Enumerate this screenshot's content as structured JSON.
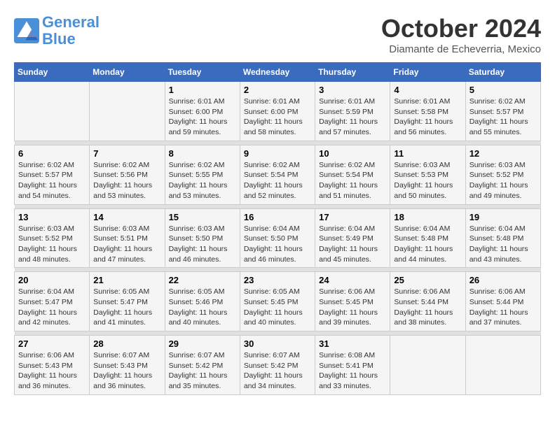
{
  "header": {
    "logo_line1": "General",
    "logo_line2": "Blue",
    "month": "October 2024",
    "location": "Diamante de Echeverria, Mexico"
  },
  "weekdays": [
    "Sunday",
    "Monday",
    "Tuesday",
    "Wednesday",
    "Thursday",
    "Friday",
    "Saturday"
  ],
  "weeks": [
    [
      {
        "day": "",
        "info": ""
      },
      {
        "day": "",
        "info": ""
      },
      {
        "day": "1",
        "info": "Sunrise: 6:01 AM\nSunset: 6:00 PM\nDaylight: 11 hours and 59 minutes."
      },
      {
        "day": "2",
        "info": "Sunrise: 6:01 AM\nSunset: 6:00 PM\nDaylight: 11 hours and 58 minutes."
      },
      {
        "day": "3",
        "info": "Sunrise: 6:01 AM\nSunset: 5:59 PM\nDaylight: 11 hours and 57 minutes."
      },
      {
        "day": "4",
        "info": "Sunrise: 6:01 AM\nSunset: 5:58 PM\nDaylight: 11 hours and 56 minutes."
      },
      {
        "day": "5",
        "info": "Sunrise: 6:02 AM\nSunset: 5:57 PM\nDaylight: 11 hours and 55 minutes."
      }
    ],
    [
      {
        "day": "6",
        "info": "Sunrise: 6:02 AM\nSunset: 5:57 PM\nDaylight: 11 hours and 54 minutes."
      },
      {
        "day": "7",
        "info": "Sunrise: 6:02 AM\nSunset: 5:56 PM\nDaylight: 11 hours and 53 minutes."
      },
      {
        "day": "8",
        "info": "Sunrise: 6:02 AM\nSunset: 5:55 PM\nDaylight: 11 hours and 53 minutes."
      },
      {
        "day": "9",
        "info": "Sunrise: 6:02 AM\nSunset: 5:54 PM\nDaylight: 11 hours and 52 minutes."
      },
      {
        "day": "10",
        "info": "Sunrise: 6:02 AM\nSunset: 5:54 PM\nDaylight: 11 hours and 51 minutes."
      },
      {
        "day": "11",
        "info": "Sunrise: 6:03 AM\nSunset: 5:53 PM\nDaylight: 11 hours and 50 minutes."
      },
      {
        "day": "12",
        "info": "Sunrise: 6:03 AM\nSunset: 5:52 PM\nDaylight: 11 hours and 49 minutes."
      }
    ],
    [
      {
        "day": "13",
        "info": "Sunrise: 6:03 AM\nSunset: 5:52 PM\nDaylight: 11 hours and 48 minutes."
      },
      {
        "day": "14",
        "info": "Sunrise: 6:03 AM\nSunset: 5:51 PM\nDaylight: 11 hours and 47 minutes."
      },
      {
        "day": "15",
        "info": "Sunrise: 6:03 AM\nSunset: 5:50 PM\nDaylight: 11 hours and 46 minutes."
      },
      {
        "day": "16",
        "info": "Sunrise: 6:04 AM\nSunset: 5:50 PM\nDaylight: 11 hours and 46 minutes."
      },
      {
        "day": "17",
        "info": "Sunrise: 6:04 AM\nSunset: 5:49 PM\nDaylight: 11 hours and 45 minutes."
      },
      {
        "day": "18",
        "info": "Sunrise: 6:04 AM\nSunset: 5:48 PM\nDaylight: 11 hours and 44 minutes."
      },
      {
        "day": "19",
        "info": "Sunrise: 6:04 AM\nSunset: 5:48 PM\nDaylight: 11 hours and 43 minutes."
      }
    ],
    [
      {
        "day": "20",
        "info": "Sunrise: 6:04 AM\nSunset: 5:47 PM\nDaylight: 11 hours and 42 minutes."
      },
      {
        "day": "21",
        "info": "Sunrise: 6:05 AM\nSunset: 5:47 PM\nDaylight: 11 hours and 41 minutes."
      },
      {
        "day": "22",
        "info": "Sunrise: 6:05 AM\nSunset: 5:46 PM\nDaylight: 11 hours and 40 minutes."
      },
      {
        "day": "23",
        "info": "Sunrise: 6:05 AM\nSunset: 5:45 PM\nDaylight: 11 hours and 40 minutes."
      },
      {
        "day": "24",
        "info": "Sunrise: 6:06 AM\nSunset: 5:45 PM\nDaylight: 11 hours and 39 minutes."
      },
      {
        "day": "25",
        "info": "Sunrise: 6:06 AM\nSunset: 5:44 PM\nDaylight: 11 hours and 38 minutes."
      },
      {
        "day": "26",
        "info": "Sunrise: 6:06 AM\nSunset: 5:44 PM\nDaylight: 11 hours and 37 minutes."
      }
    ],
    [
      {
        "day": "27",
        "info": "Sunrise: 6:06 AM\nSunset: 5:43 PM\nDaylight: 11 hours and 36 minutes."
      },
      {
        "day": "28",
        "info": "Sunrise: 6:07 AM\nSunset: 5:43 PM\nDaylight: 11 hours and 36 minutes."
      },
      {
        "day": "29",
        "info": "Sunrise: 6:07 AM\nSunset: 5:42 PM\nDaylight: 11 hours and 35 minutes."
      },
      {
        "day": "30",
        "info": "Sunrise: 6:07 AM\nSunset: 5:42 PM\nDaylight: 11 hours and 34 minutes."
      },
      {
        "day": "31",
        "info": "Sunrise: 6:08 AM\nSunset: 5:41 PM\nDaylight: 11 hours and 33 minutes."
      },
      {
        "day": "",
        "info": ""
      },
      {
        "day": "",
        "info": ""
      }
    ]
  ]
}
